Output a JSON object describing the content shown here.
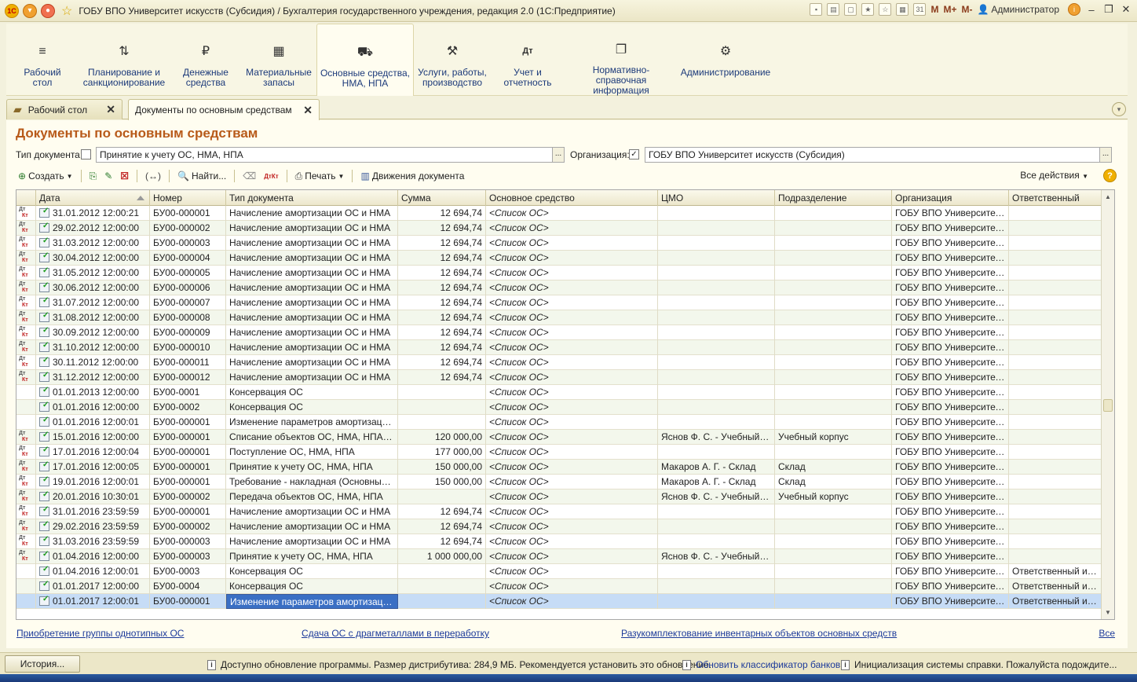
{
  "window": {
    "title": "ГОБУ ВПО Университет искусств (Субсидия) / Бухгалтерия государственного учреждения, редакция 2.0  (1С:Предприятие)",
    "logo": "1С",
    "user": "Администратор",
    "m_buttons": [
      "M",
      "M+",
      "M-"
    ]
  },
  "sections": [
    {
      "label": "Рабочий\nстол",
      "icon": "menu-lines-icon",
      "glyph": "≡"
    },
    {
      "label": "Планирование и\nсанкционирование",
      "icon": "planning-icon",
      "glyph": "⇅"
    },
    {
      "label": "Денежные\nсредства",
      "icon": "ruble-coin-icon",
      "glyph": "₽"
    },
    {
      "label": "Материальные\nзапасы",
      "icon": "grid-blocks-icon",
      "glyph": "▦"
    },
    {
      "label": "Основные средства,\nНМА, НПА",
      "icon": "truck-icon",
      "glyph": "⛟"
    },
    {
      "label": "Услуги, работы,\nпроизводство",
      "icon": "tools-icon",
      "glyph": "⚒"
    },
    {
      "label": "Учет и\nотчетность",
      "icon": "debit-credit-icon",
      "glyph": "Дт"
    },
    {
      "label": "Нормативно-справочная\nинформация",
      "icon": "documents-icon",
      "glyph": "❐"
    },
    {
      "label": "Администрирование",
      "icon": "gear-icon",
      "glyph": "⚙"
    }
  ],
  "tabs": [
    {
      "label": "Рабочий стол"
    },
    {
      "label": "Документы по основным средствам"
    }
  ],
  "form": {
    "title": "Документы по основным средствам",
    "doc_type_label": "Тип документа:",
    "doc_type_checked": false,
    "doc_type_value": "Принятие к учету ОС, НМА, НПА",
    "org_label": "Организация:",
    "org_checked": true,
    "org_value": "ГОБУ ВПО Университет искусств (Субсидия)",
    "select_button": "...",
    "check_mark": "✓"
  },
  "toolbar": {
    "create": "Создать",
    "find": "Найти...",
    "print": "Печать",
    "movements": "Движения документа",
    "all_actions": "Все действия",
    "help": "?"
  },
  "table": {
    "columns": [
      "Дата",
      "Номер",
      "Тип документа",
      "Сумма",
      "Основное средство",
      "ЦМО",
      "Подразделение",
      "Организация",
      "Ответственный"
    ],
    "rows": [
      {
        "dtkt": true,
        "date": "31.01.2012 12:00:21",
        "num": "БУ00-000001",
        "type": "Начисление амортизации ОС и НМА",
        "sum": "12 694,74",
        "os": "<Список ОС>",
        "cmo": "",
        "dept": "",
        "org": "ГОБУ ВПО Университет ...",
        "resp": ""
      },
      {
        "dtkt": true,
        "date": "29.02.2012 12:00:00",
        "num": "БУ00-000002",
        "type": "Начисление амортизации ОС и НМА",
        "sum": "12 694,74",
        "os": "<Список ОС>",
        "cmo": "",
        "dept": "",
        "org": "ГОБУ ВПО Университет ...",
        "resp": ""
      },
      {
        "dtkt": true,
        "date": "31.03.2012 12:00:00",
        "num": "БУ00-000003",
        "type": "Начисление амортизации ОС и НМА",
        "sum": "12 694,74",
        "os": "<Список ОС>",
        "cmo": "",
        "dept": "",
        "org": "ГОБУ ВПО Университет ...",
        "resp": ""
      },
      {
        "dtkt": true,
        "date": "30.04.2012 12:00:00",
        "num": "БУ00-000004",
        "type": "Начисление амортизации ОС и НМА",
        "sum": "12 694,74",
        "os": "<Список ОС>",
        "cmo": "",
        "dept": "",
        "org": "ГОБУ ВПО Университет ...",
        "resp": ""
      },
      {
        "dtkt": true,
        "date": "31.05.2012 12:00:00",
        "num": "БУ00-000005",
        "type": "Начисление амортизации ОС и НМА",
        "sum": "12 694,74",
        "os": "<Список ОС>",
        "cmo": "",
        "dept": "",
        "org": "ГОБУ ВПО Университет ...",
        "resp": ""
      },
      {
        "dtkt": true,
        "date": "30.06.2012 12:00:00",
        "num": "БУ00-000006",
        "type": "Начисление амортизации ОС и НМА",
        "sum": "12 694,74",
        "os": "<Список ОС>",
        "cmo": "",
        "dept": "",
        "org": "ГОБУ ВПО Университет ...",
        "resp": ""
      },
      {
        "dtkt": true,
        "date": "31.07.2012 12:00:00",
        "num": "БУ00-000007",
        "type": "Начисление амортизации ОС и НМА",
        "sum": "12 694,74",
        "os": "<Список ОС>",
        "cmo": "",
        "dept": "",
        "org": "ГОБУ ВПО Университет ...",
        "resp": ""
      },
      {
        "dtkt": true,
        "date": "31.08.2012 12:00:00",
        "num": "БУ00-000008",
        "type": "Начисление амортизации ОС и НМА",
        "sum": "12 694,74",
        "os": "<Список ОС>",
        "cmo": "",
        "dept": "",
        "org": "ГОБУ ВПО Университет ...",
        "resp": ""
      },
      {
        "dtkt": true,
        "date": "30.09.2012 12:00:00",
        "num": "БУ00-000009",
        "type": "Начисление амортизации ОС и НМА",
        "sum": "12 694,74",
        "os": "<Список ОС>",
        "cmo": "",
        "dept": "",
        "org": "ГОБУ ВПО Университет ...",
        "resp": ""
      },
      {
        "dtkt": true,
        "date": "31.10.2012 12:00:00",
        "num": "БУ00-000010",
        "type": "Начисление амортизации ОС и НМА",
        "sum": "12 694,74",
        "os": "<Список ОС>",
        "cmo": "",
        "dept": "",
        "org": "ГОБУ ВПО Университет ...",
        "resp": ""
      },
      {
        "dtkt": true,
        "date": "30.11.2012 12:00:00",
        "num": "БУ00-000011",
        "type": "Начисление амортизации ОС и НМА",
        "sum": "12 694,74",
        "os": "<Список ОС>",
        "cmo": "",
        "dept": "",
        "org": "ГОБУ ВПО Университет ...",
        "resp": ""
      },
      {
        "dtkt": true,
        "date": "31.12.2012 12:00:00",
        "num": "БУ00-000012",
        "type": "Начисление амортизации ОС и НМА",
        "sum": "12 694,74",
        "os": "<Список ОС>",
        "cmo": "",
        "dept": "",
        "org": "ГОБУ ВПО Университет ...",
        "resp": ""
      },
      {
        "dtkt": false,
        "date": "01.01.2013 12:00:00",
        "num": "БУ00-0001",
        "type": "Консервация ОС",
        "sum": "",
        "os": "<Список ОС>",
        "cmo": "",
        "dept": "",
        "org": "ГОБУ ВПО Университет ...",
        "resp": ""
      },
      {
        "dtkt": false,
        "date": "01.01.2016 12:00:00",
        "num": "БУ00-0002",
        "type": "Консервация ОС",
        "sum": "",
        "os": "<Список ОС>",
        "cmo": "",
        "dept": "",
        "org": "ГОБУ ВПО Университет ...",
        "resp": ""
      },
      {
        "dtkt": false,
        "date": "01.01.2016 12:00:01",
        "num": "БУ00-000001",
        "type": "Изменение параметров амортизации ...",
        "sum": "",
        "os": "<Список ОС>",
        "cmo": "",
        "dept": "",
        "org": "ГОБУ ВПО Университет ...",
        "resp": ""
      },
      {
        "dtkt": true,
        "date": "15.01.2016 12:00:00",
        "num": "БУ00-000001",
        "type": "Списание объектов ОС, НМА, НПА (кро...",
        "sum": "120 000,00",
        "os": "<Список ОС>",
        "cmo": "Яснов Ф. С. - Учебный ко...",
        "dept": "Учебный корпус",
        "org": "ГОБУ ВПО Университет ...",
        "resp": ""
      },
      {
        "dtkt": true,
        "date": "17.01.2016 12:00:04",
        "num": "БУ00-000001",
        "type": "Поступление ОС, НМА, НПА",
        "sum": "177 000,00",
        "os": "<Список ОС>",
        "cmo": "",
        "dept": "",
        "org": "ГОБУ ВПО Университет ...",
        "resp": ""
      },
      {
        "dtkt": true,
        "date": "17.01.2016 12:00:05",
        "num": "БУ00-000001",
        "type": "Принятие к учету ОС, НМА, НПА",
        "sum": "150 000,00",
        "os": "<Список ОС>",
        "cmo": "Макаров А. Г. - Склад",
        "dept": "Склад",
        "org": "ГОБУ ВПО Университет ...",
        "resp": ""
      },
      {
        "dtkt": true,
        "date": "19.01.2016 12:00:01",
        "num": "БУ00-000001",
        "type": "Требование - накладная (Основные ср...",
        "sum": "150 000,00",
        "os": "<Список ОС>",
        "cmo": "Макаров А. Г. - Склад",
        "dept": "Склад",
        "org": "ГОБУ ВПО Университет ...",
        "resp": ""
      },
      {
        "dtkt": true,
        "date": "20.01.2016 10:30:01",
        "num": "БУ00-000002",
        "type": "Передача объектов ОС, НМА, НПА",
        "sum": "",
        "os": "<Список ОС>",
        "cmo": "Яснов Ф. С. - Учебный ко...",
        "dept": "Учебный корпус",
        "org": "ГОБУ ВПО Университет ...",
        "resp": ""
      },
      {
        "dtkt": true,
        "date": "31.01.2016 23:59:59",
        "num": "БУ00-000001",
        "type": "Начисление амортизации ОС и НМА",
        "sum": "12 694,74",
        "os": "<Список ОС>",
        "cmo": "",
        "dept": "",
        "org": "ГОБУ ВПО Университет ...",
        "resp": ""
      },
      {
        "dtkt": true,
        "date": "29.02.2016 23:59:59",
        "num": "БУ00-000002",
        "type": "Начисление амортизации ОС и НМА",
        "sum": "12 694,74",
        "os": "<Список ОС>",
        "cmo": "",
        "dept": "",
        "org": "ГОБУ ВПО Университет ...",
        "resp": ""
      },
      {
        "dtkt": true,
        "date": "31.03.2016 23:59:59",
        "num": "БУ00-000003",
        "type": "Начисление амортизации ОС и НМА",
        "sum": "12 694,74",
        "os": "<Список ОС>",
        "cmo": "",
        "dept": "",
        "org": "ГОБУ ВПО Университет ...",
        "resp": ""
      },
      {
        "dtkt": true,
        "date": "01.04.2016 12:00:00",
        "num": "БУ00-000003",
        "type": "Принятие к учету ОС, НМА, НПА",
        "sum": "1 000 000,00",
        "os": "<Список ОС>",
        "cmo": "Яснов Ф. С. - Учебный ко...",
        "dept": "",
        "org": "ГОБУ ВПО Университет ...",
        "resp": ""
      },
      {
        "dtkt": false,
        "date": "01.04.2016 12:00:01",
        "num": "БУ00-0003",
        "type": "Консервация ОС",
        "sum": "",
        "os": "<Список ОС>",
        "cmo": "",
        "dept": "",
        "org": "ГОБУ ВПО Университет ...",
        "resp": "Ответственный ис..."
      },
      {
        "dtkt": false,
        "date": "01.01.2017 12:00:00",
        "num": "БУ00-0004",
        "type": "Консервация ОС",
        "sum": "",
        "os": "<Список ОС>",
        "cmo": "",
        "dept": "",
        "org": "ГОБУ ВПО Университет ...",
        "resp": "Ответственный ис..."
      },
      {
        "dtkt": false,
        "date": "01.01.2017 12:00:01",
        "num": "БУ00-000001",
        "type": "Изменение параметров амортизации ...",
        "sum": "",
        "os": "<Список ОС>",
        "cmo": "",
        "dept": "",
        "org": "ГОБУ ВПО Университет ...",
        "resp": "Ответственный ис...",
        "selected": true
      }
    ]
  },
  "links": [
    "Приобретение группы однотипных ОС",
    "Сдача ОС с драгметаллами в переработку",
    "Разукомплектование инвентарных объектов основных средств",
    "Все"
  ],
  "status": {
    "history": "История...",
    "msg1": "Доступно обновление программы. Размер дистрибутива: 284,9 МБ. Рекомендуется установить это обновление.",
    "msg2": "Обновить классификатор банков",
    "msg3": "Инициализация системы справки. Пожалуйста подождите...",
    "info_glyph": "i"
  }
}
